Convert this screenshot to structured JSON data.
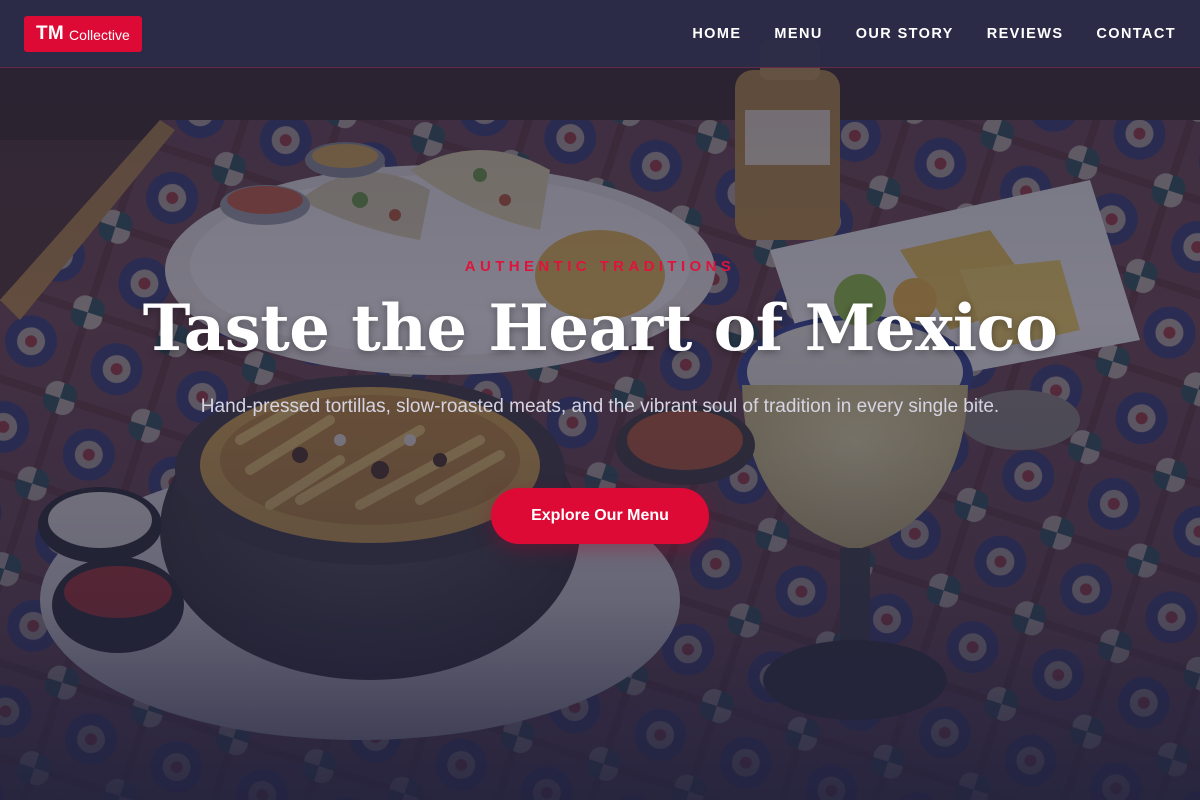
{
  "header": {
    "logo_mark": "TM",
    "logo_word": "Collective",
    "nav": [
      {
        "label": "HOME"
      },
      {
        "label": "MENU"
      },
      {
        "label": "OUR STORY"
      },
      {
        "label": "REVIEWS"
      },
      {
        "label": "CONTACT"
      }
    ]
  },
  "hero": {
    "eyebrow": "AUTHENTIC TRADITIONS",
    "title": "Taste the Heart of Mexico",
    "subtitle": "Hand-pressed tortillas, slow-roasted meats, and the vibrant soul of tradition in every single bite.",
    "cta_label": "Explore Our Menu"
  },
  "colors": {
    "accent": "#dc0a35",
    "header_bg": "#2c2c48",
    "overlay": "#23233e"
  }
}
